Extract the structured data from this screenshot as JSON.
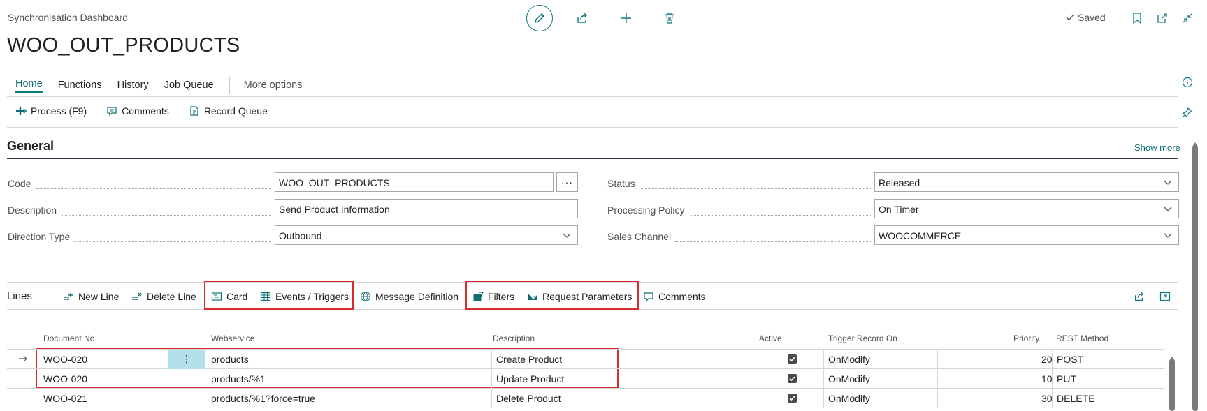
{
  "header": {
    "breadcrumb": "Synchronisation Dashboard",
    "title": "WOO_OUT_PRODUCTS",
    "status": "Saved"
  },
  "nav": {
    "tabs": [
      {
        "label": "Home",
        "active": true
      },
      {
        "label": "Functions"
      },
      {
        "label": "History"
      },
      {
        "label": "Job Queue"
      }
    ],
    "more": "More options"
  },
  "actions": {
    "process": "Process (F9)",
    "comments": "Comments",
    "record_queue": "Record Queue"
  },
  "general": {
    "title": "General",
    "show_more": "Show more",
    "fields": {
      "code": {
        "label": "Code",
        "value": "WOO_OUT_PRODUCTS"
      },
      "description": {
        "label": "Description",
        "value": "Send Product Information"
      },
      "direction_type": {
        "label": "Direction Type",
        "value": "Outbound"
      },
      "status": {
        "label": "Status",
        "value": "Released"
      },
      "processing_policy": {
        "label": "Processing Policy",
        "value": "On Timer"
      },
      "sales_channel": {
        "label": "Sales Channel",
        "value": "WOOCOMMERCE"
      }
    }
  },
  "lines": {
    "title": "Lines",
    "toolbar": {
      "new_line": "New Line",
      "delete_line": "Delete Line",
      "card": "Card",
      "events_triggers": "Events / Triggers",
      "message_definition": "Message Definition",
      "filters": "Filters",
      "request_parameters": "Request Parameters",
      "comments": "Comments"
    },
    "columns": {
      "document_no": "Document No.",
      "webservice": "Webservice",
      "description": "Description",
      "active": "Active",
      "trigger_record_on": "Trigger Record On",
      "priority": "Priority",
      "rest_method": "REST Method"
    },
    "rows": [
      {
        "document_no": "WOO-020",
        "webservice": "products",
        "description": "Create Product",
        "active": true,
        "trigger_record_on": "OnModify",
        "priority": "20",
        "rest_method": "POST"
      },
      {
        "document_no": "WOO-020",
        "webservice": "products/%1",
        "description": "Update Product",
        "active": true,
        "trigger_record_on": "OnModify",
        "priority": "10",
        "rest_method": "PUT"
      },
      {
        "document_no": "WOO-021",
        "webservice": "products/%1?force=true",
        "description": "Delete Product",
        "active": true,
        "trigger_record_on": "OnModify",
        "priority": "30",
        "rest_method": "DELETE"
      }
    ]
  },
  "colors": {
    "accent": "#0d7a80",
    "highlight": "#d62b2b",
    "selected_cell": "#b3e0ea"
  },
  "icons": [
    "pencil-icon",
    "share-icon",
    "plus-icon",
    "trash-icon",
    "check-icon",
    "bookmark-icon",
    "open-new-icon",
    "collapse-icon",
    "info-icon",
    "pin-icon"
  ]
}
